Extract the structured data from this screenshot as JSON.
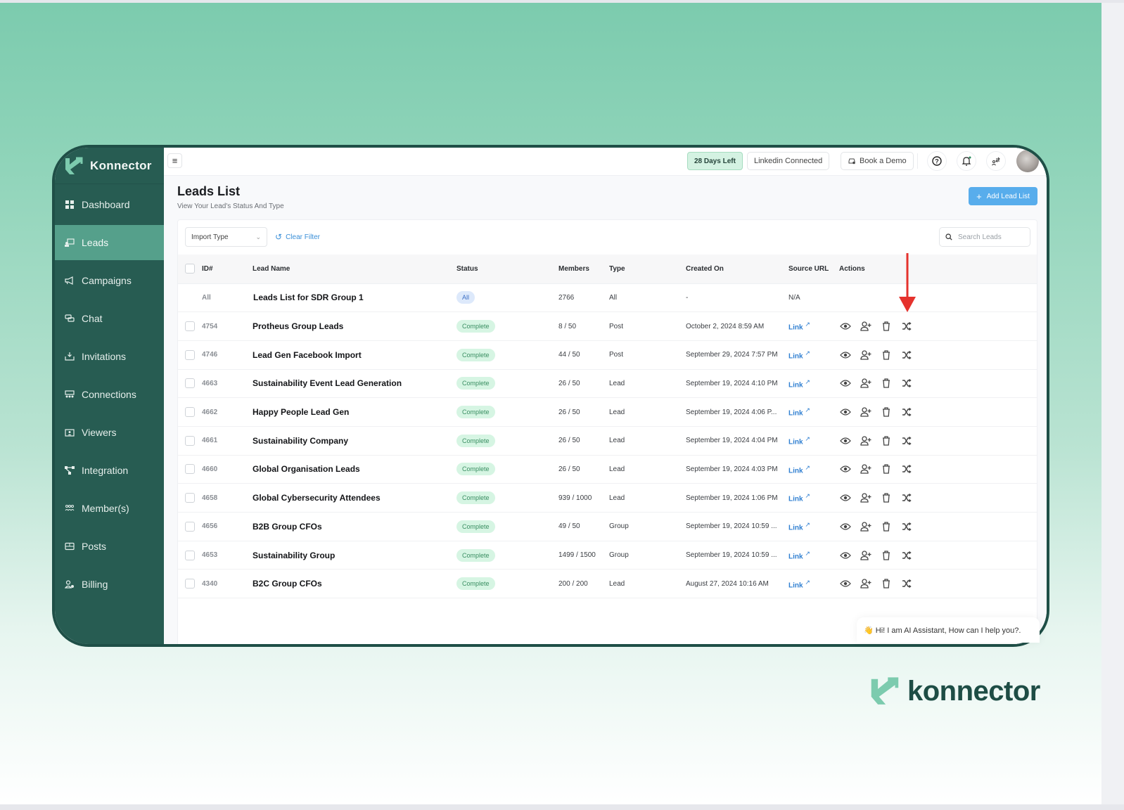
{
  "brand": {
    "name": "Konnector",
    "footer_wordmark": "konnector"
  },
  "sidebar": {
    "items": [
      {
        "label": "Dashboard",
        "icon": "dashboard-icon",
        "active": false
      },
      {
        "label": "Leads",
        "icon": "leads-icon",
        "active": true
      },
      {
        "label": "Campaigns",
        "icon": "megaphone-icon",
        "active": false
      },
      {
        "label": "Chat",
        "icon": "chat-icon",
        "active": false
      },
      {
        "label": "Invitations",
        "icon": "inbox-icon",
        "active": false
      },
      {
        "label": "Connections",
        "icon": "network-icon",
        "active": false
      },
      {
        "label": "Viewers",
        "icon": "viewer-icon",
        "active": false
      },
      {
        "label": "Integration",
        "icon": "integration-icon",
        "active": false
      },
      {
        "label": "Member(s)",
        "icon": "members-icon",
        "active": false
      },
      {
        "label": "Posts",
        "icon": "posts-icon",
        "active": false
      },
      {
        "label": "Billing",
        "icon": "billing-icon",
        "active": false
      }
    ]
  },
  "topbar": {
    "days_left": "28 Days Left",
    "linkedin_status": "Linkedin Connected",
    "book_demo": "Book a Demo"
  },
  "page": {
    "title": "Leads List",
    "subtitle": "View Your Lead's Status And Type",
    "add_button": "Add Lead List"
  },
  "filters": {
    "import_type": "Import Type",
    "clear_filter": "Clear Filter",
    "search_placeholder": "Search Leads"
  },
  "table": {
    "headers": [
      "ID#",
      "Lead Name",
      "Status",
      "Members",
      "Type",
      "Created On",
      "Source URL",
      "Actions"
    ],
    "summary_row": {
      "id": "All",
      "name": "Leads List for SDR Group 1",
      "status": "All",
      "members": "2766",
      "type": "All",
      "created": "-",
      "source": "N/A"
    },
    "rows": [
      {
        "id": "4754",
        "name": "Protheus Group Leads",
        "status": "Complete",
        "members": "8 / 50",
        "type": "Post",
        "created": "October 2, 2024 8:59 AM",
        "source": "Link"
      },
      {
        "id": "4746",
        "name": "Lead Gen Facebook Import",
        "status": "Complete",
        "members": "44 / 50",
        "type": "Post",
        "created": "September 29, 2024 7:57 PM",
        "source": "Link"
      },
      {
        "id": "4663",
        "name": "Sustainability Event Lead Generation",
        "status": "Complete",
        "members": "26 / 50",
        "type": "Lead",
        "created": "September 19, 2024 4:10 PM",
        "source": "Link"
      },
      {
        "id": "4662",
        "name": "Happy People Lead Gen",
        "status": "Complete",
        "members": "26 / 50",
        "type": "Lead",
        "created": "September 19, 2024 4:06 P...",
        "source": "Link"
      },
      {
        "id": "4661",
        "name": "Sustainability Company",
        "status": "Complete",
        "members": "26 / 50",
        "type": "Lead",
        "created": "September 19, 2024 4:04 PM",
        "source": "Link"
      },
      {
        "id": "4660",
        "name": "Global Organisation Leads",
        "status": "Complete",
        "members": "26 / 50",
        "type": "Lead",
        "created": "September 19, 2024 4:03 PM",
        "source": "Link"
      },
      {
        "id": "4658",
        "name": "Global Cybersecurity Attendees",
        "status": "Complete",
        "members": "939 / 1000",
        "type": "Lead",
        "created": "September 19, 2024 1:06 PM",
        "source": "Link"
      },
      {
        "id": "4656",
        "name": "B2B Group CFOs",
        "status": "Complete",
        "members": "49 / 50",
        "type": "Group",
        "created": "September 19, 2024 10:59 ...",
        "source": "Link"
      },
      {
        "id": "4653",
        "name": "Sustainability Group",
        "status": "Complete",
        "members": "1499 / 1500",
        "type": "Group",
        "created": "September 19, 2024 10:59 ...",
        "source": "Link"
      },
      {
        "id": "4340",
        "name": "B2C Group CFOs",
        "status": "Complete",
        "members": "200 / 200",
        "type": "Lead",
        "created": "August 27, 2024 10:16 AM",
        "source": "Link"
      }
    ],
    "row_actions": [
      "view-icon",
      "add-user-icon",
      "trash-icon",
      "shuffle-icon"
    ]
  },
  "chat": {
    "greeting": "👋 Hi! I am AI Assistant, How can I help you?."
  },
  "colors": {
    "sidebar": "#275c52",
    "sidebar_active": "#55a08b",
    "accent_blue": "#58adec",
    "complete_bg": "#d6f5e3",
    "complete_text": "#3a8e62",
    "annotation_arrow": "#e5322d"
  }
}
